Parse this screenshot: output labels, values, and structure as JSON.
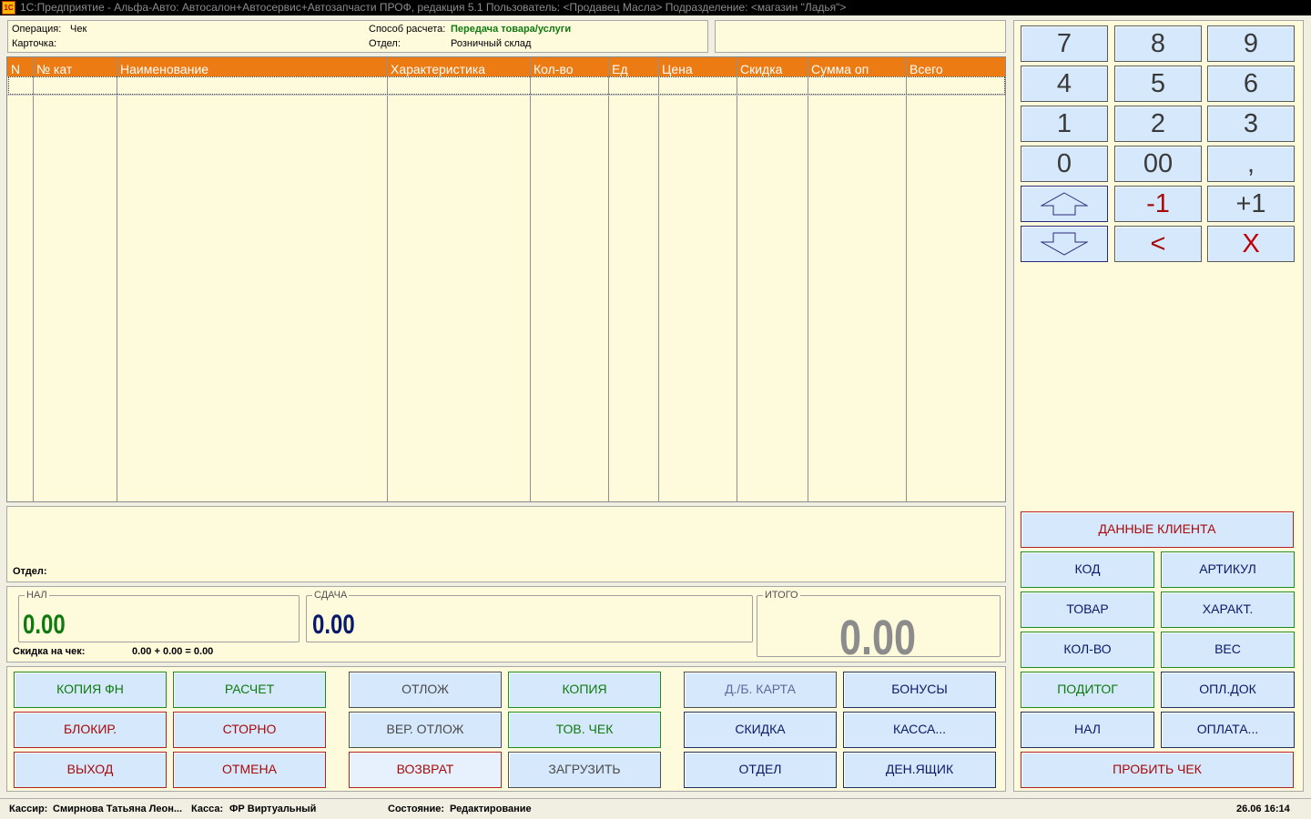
{
  "window": {
    "icon_text": "1С",
    "title": "1С:Предприятие - Альфа-Авто: Автосалон+Автосервис+Автозапчасти ПРОФ, редакция 5.1    Пользователь: <Продавец Масла>    Подразделение: <магазин \"Ладья\">"
  },
  "info": {
    "operation_label": "Операция:",
    "operation_value": "Чек",
    "card_label": "Карточка:",
    "payment_label": "Способ расчета:",
    "payment_value": "Передача товара/услуги",
    "dept_label": "Отдел:",
    "dept_value": "Розничный склад"
  },
  "table": {
    "columns": [
      "N",
      "№ кат",
      "Наименование",
      "Характеристика",
      "Кол-во",
      "Ед",
      "Цена",
      "Скидка",
      "Сумма оп",
      "Всего"
    ],
    "rows": []
  },
  "detail": {
    "dept_label": "Отдел:"
  },
  "totals": {
    "cash_label": "НАЛ",
    "cash_value": "0.00",
    "change_label": "СДАЧА",
    "change_value": "0.00",
    "total_label": "ИТОГО",
    "total_value": "0.00",
    "discount_label": "Скидка на чек:",
    "discount_value": "0.00 + 0.00 = 0.00"
  },
  "actions": {
    "copy_fn": "КОПИЯ ФН",
    "calc": "РАСЧЕТ",
    "defer": "ОТЛОЖ",
    "copy": "КОПИЯ",
    "discount_card": "Д./Б. КАРТА",
    "bonuses": "БОНУСЫ",
    "block": "БЛОКИР.",
    "storno": "СТОРНО",
    "return_deferred": "ВЕР. ОТЛОЖ",
    "goods_check": "ТОВ. ЧЕК",
    "discount": "СКИДКА",
    "cashbox": "КАССА...",
    "exit": "ВЫХОД",
    "cancel": "ОТМЕНА",
    "refund": "ВОЗВРАТ",
    "load": "ЗАГРУЗИТЬ",
    "department": "ОТДЕЛ",
    "cash_drawer": "ДЕН.ЯЩИК"
  },
  "numpad": {
    "k7": "7",
    "k8": "8",
    "k9": "9",
    "k4": "4",
    "k5": "5",
    "k6": "6",
    "k1": "1",
    "k2": "2",
    "k3": "3",
    "k0": "0",
    "k00": "00",
    "kcomma": ",",
    "minus1": "-1",
    "plus1": "+1",
    "back": "<",
    "clear": "X",
    "up_icon": "arrow-up-icon",
    "down_icon": "arrow-down-icon"
  },
  "right_buttons": {
    "client_data": "ДАННЫЕ КЛИЕНТА",
    "code": "КОД",
    "article": "АРТИКУЛ",
    "goods": "ТОВАР",
    "charact": "ХАРАКТ.",
    "qty": "КОЛ-ВО",
    "weight": "ВЕС",
    "subtotal": "ПОДИТОГ",
    "pay_doc": "ОПЛ.ДОК",
    "cash": "НАЛ",
    "payment": "ОПЛАТА...",
    "print_check": "ПРОБИТЬ ЧЕК"
  },
  "status": {
    "cashier_label": "Кассир:",
    "cashier_value": "Смирнова Татьяна Леон...",
    "register_label": "Касса:",
    "register_value": "ФР Виртуальный",
    "state_label": "Состояние:",
    "state_value": "Редактирование",
    "datetime": "26.06 16:14"
  },
  "colors": {
    "header_orange": "#ec7b13",
    "panel_bg": "#fefadc",
    "button_bg": "#d6e8fb",
    "green": "#0f7a0f",
    "red": "#a70a0a",
    "navy": "#0a1a6b",
    "gray_total": "#8c8c8c"
  }
}
